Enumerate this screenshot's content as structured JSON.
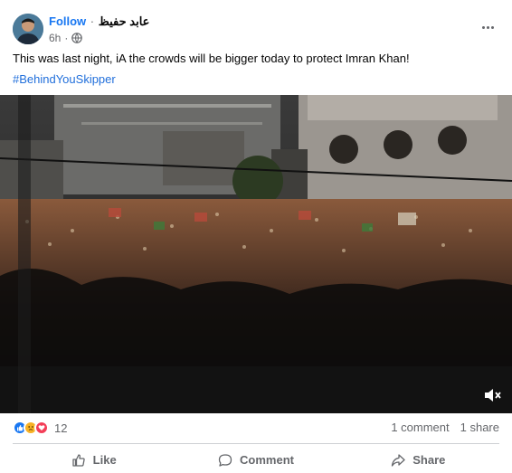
{
  "post": {
    "follow_label": "Follow",
    "separator": "·",
    "author_name": "عابد حفيظ",
    "time": "6h",
    "privacy_icon": "globe-icon",
    "more_icon": "more-options-icon",
    "text": "This was last night, iA the crowds will be bigger today to protect Imran Khan!",
    "hashtag": "#BehindYouSkipper"
  },
  "video": {
    "mute_icon": "speaker-muted-icon"
  },
  "stats": {
    "reaction_icons": [
      "like-reaction-icon",
      "sad-reaction-icon",
      "love-reaction-icon"
    ],
    "reaction_count": "12",
    "comments": "1 comment",
    "shares": "1 share"
  },
  "actions": {
    "like_label": "Like",
    "comment_label": "Comment",
    "share_label": "Share"
  },
  "colors": {
    "link_blue": "#1877f2",
    "hashtag_blue": "#216fdb",
    "muted_text": "#65676b",
    "divider": "#ced0d4"
  }
}
